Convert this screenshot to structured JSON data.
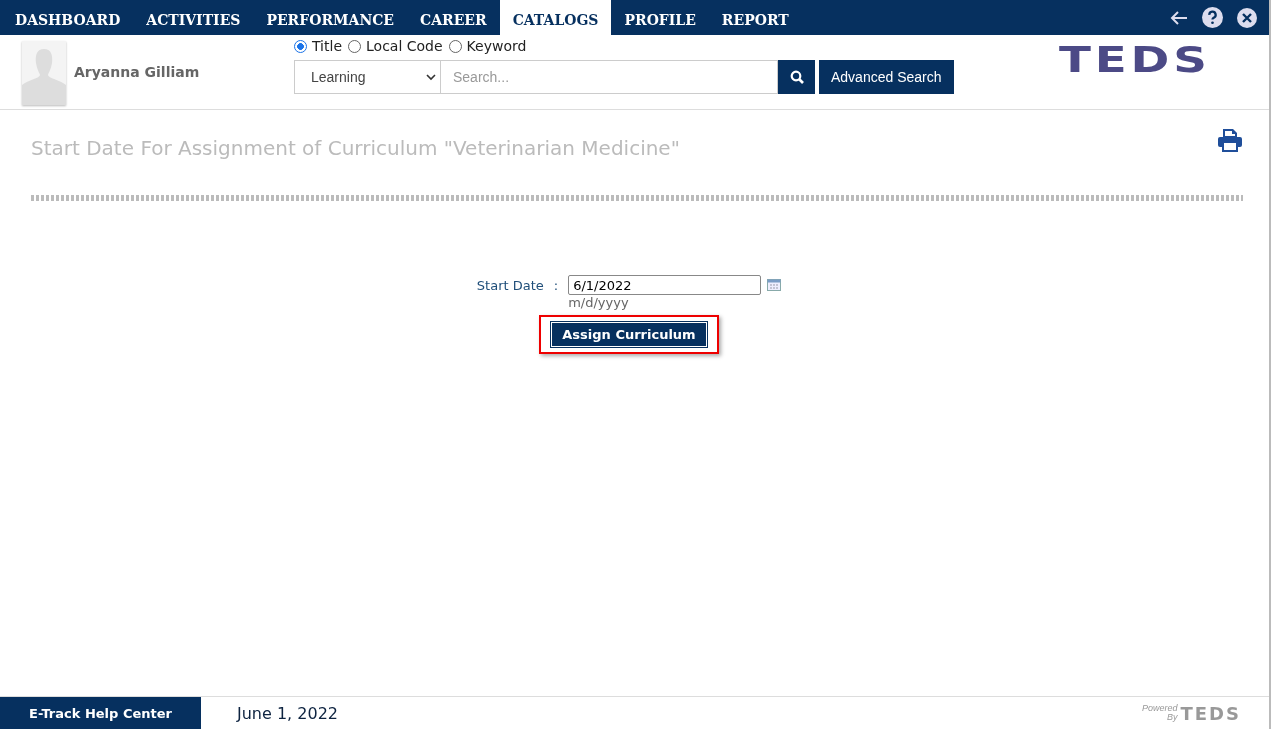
{
  "nav": {
    "tabs": [
      {
        "label": "DASHBOARD",
        "selected": false
      },
      {
        "label": "ACTIVITIES",
        "selected": false
      },
      {
        "label": "PERFORMANCE",
        "selected": false
      },
      {
        "label": "CAREER",
        "selected": false
      },
      {
        "label": "CATALOGS",
        "selected": true
      },
      {
        "label": "PROFILE",
        "selected": false
      },
      {
        "label": "REPORT",
        "selected": false
      }
    ]
  },
  "user": {
    "name": "Aryanna Gilliam"
  },
  "search": {
    "modes": [
      {
        "label": "Title",
        "selected": true
      },
      {
        "label": "Local Code",
        "selected": false
      },
      {
        "label": "Keyword",
        "selected": false
      }
    ],
    "category": "Learning",
    "placeholder": "Search...",
    "advanced_button": "Advanced Search"
  },
  "logo": "TEDS",
  "page": {
    "title": "Start Date For Assignment of Curriculum \"Veterinarian Medicine\"",
    "field_label": "Start Date",
    "separator": ":",
    "start_date": "6/1/2022",
    "format_hint": "m/d/yyyy",
    "assign_button": "Assign Curriculum"
  },
  "footer": {
    "help_link": "E-Track Help Center",
    "date": "June 1, 2022",
    "powered": "Powered",
    "by": "By",
    "logo": "TEDS"
  }
}
